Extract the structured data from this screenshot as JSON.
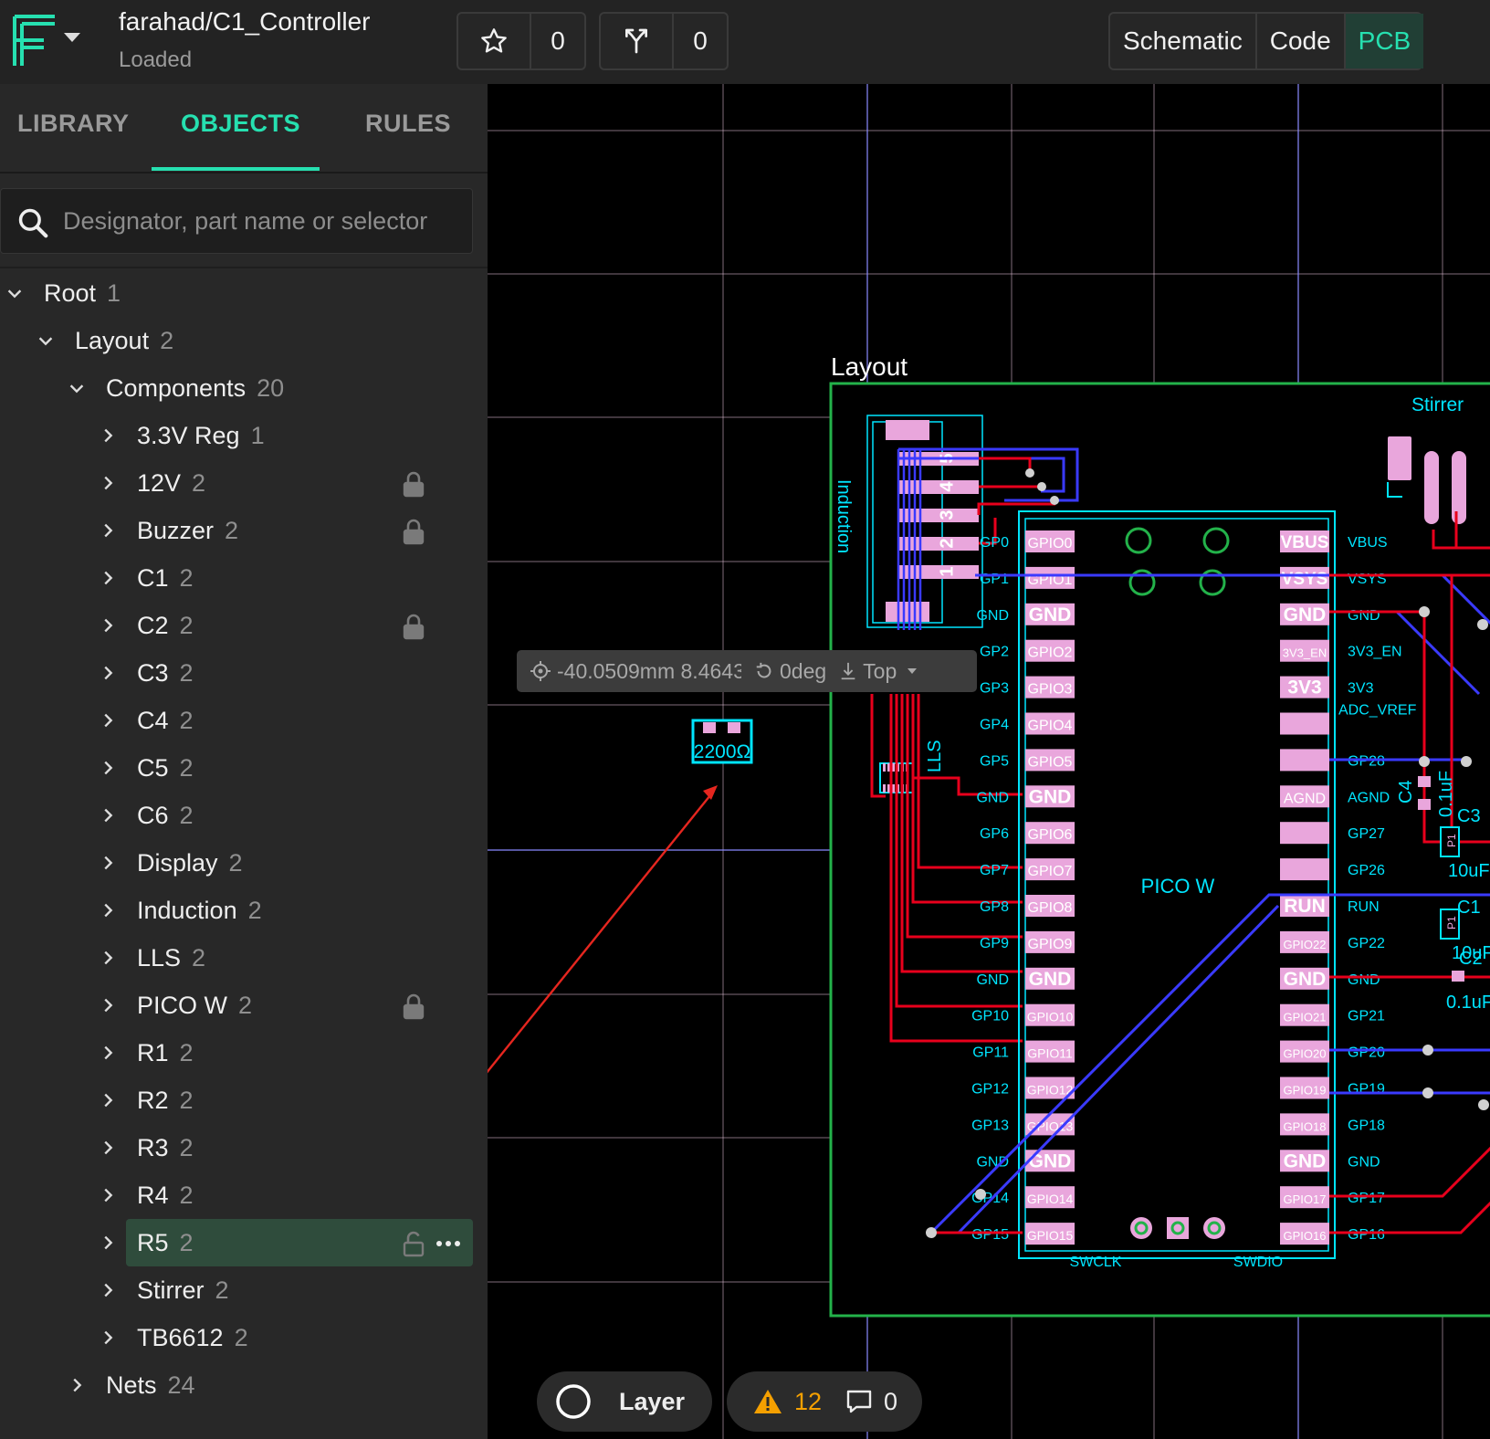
{
  "header": {
    "project_name": "farahad/C1_Controller",
    "status": "Loaded",
    "star_count": "0",
    "fork_count": "0",
    "views": [
      "Schematic",
      "Code",
      "PCB"
    ],
    "active_view": "PCB"
  },
  "sidebar": {
    "tabs": [
      "LIBRARY",
      "OBJECTS",
      "RULES"
    ],
    "active_tab": "OBJECTS",
    "search_placeholder": "Designator, part name or selector",
    "tree": {
      "root": {
        "label": "Root",
        "count": "1"
      },
      "layout": {
        "label": "Layout",
        "count": "2"
      },
      "components": {
        "label": "Components",
        "count": "20"
      },
      "items": [
        {
          "label": "3.3V Reg",
          "count": "1",
          "locked": false
        },
        {
          "label": "12V",
          "count": "2",
          "locked": true
        },
        {
          "label": "Buzzer",
          "count": "2",
          "locked": true
        },
        {
          "label": "C1",
          "count": "2",
          "locked": false
        },
        {
          "label": "C2",
          "count": "2",
          "locked": true
        },
        {
          "label": "C3",
          "count": "2",
          "locked": false
        },
        {
          "label": "C4",
          "count": "2",
          "locked": false
        },
        {
          "label": "C5",
          "count": "2",
          "locked": false
        },
        {
          "label": "C6",
          "count": "2",
          "locked": false
        },
        {
          "label": "Display",
          "count": "2",
          "locked": false
        },
        {
          "label": "Induction",
          "count": "2",
          "locked": false
        },
        {
          "label": "LLS",
          "count": "2",
          "locked": false
        },
        {
          "label": "PICO W",
          "count": "2",
          "locked": true
        },
        {
          "label": "R1",
          "count": "2",
          "locked": false
        },
        {
          "label": "R2",
          "count": "2",
          "locked": false
        },
        {
          "label": "R3",
          "count": "2",
          "locked": false
        },
        {
          "label": "R4",
          "count": "2",
          "locked": false
        },
        {
          "label": "R5",
          "count": "2",
          "locked": false,
          "selected": true
        },
        {
          "label": "Stirrer",
          "count": "2",
          "locked": false
        },
        {
          "label": "TB6612",
          "count": "2",
          "locked": false
        }
      ],
      "nets": {
        "label": "Nets",
        "count": "24"
      }
    }
  },
  "canvas": {
    "layout_label": "Layout",
    "resistor_value": "2200Ω",
    "pico_label": "PICO W",
    "induction_label": "Induction",
    "lls_label": "LLS",
    "stirrer_label": "Stirrer",
    "c4_label": "C4",
    "c3_label": "C3",
    "c4_value": "0.1uF",
    "c3_value": "10uF",
    "c2_label": "C2",
    "c1_label": "C1",
    "c2_value": "10uF",
    "c1_value": "0.1uF",
    "p1_label": "P1",
    "swclk": "SWCLK",
    "swdio": "SWDIO",
    "header_pins": [
      "5",
      "4",
      "3",
      "2",
      "1"
    ],
    "left_pins": [
      {
        "net": "GP0",
        "pad": "GPIO0"
      },
      {
        "net": "GP1",
        "pad": "GPIO1"
      },
      {
        "net": "GND",
        "pad": "GND"
      },
      {
        "net": "GP2",
        "pad": "GPIO2"
      },
      {
        "net": "GP3",
        "pad": "GPIO3"
      },
      {
        "net": "GP4",
        "pad": "GPIO4"
      },
      {
        "net": "GP5",
        "pad": "GPIO5"
      },
      {
        "net": "GND",
        "pad": "GND"
      },
      {
        "net": "GP6",
        "pad": "GPIO6"
      },
      {
        "net": "GP7",
        "pad": "GPIO7"
      },
      {
        "net": "GP8",
        "pad": "GPIO8"
      },
      {
        "net": "GP9",
        "pad": "GPIO9"
      },
      {
        "net": "GND",
        "pad": "GND"
      },
      {
        "net": "GP10",
        "pad": "GPIO10"
      },
      {
        "net": "GP11",
        "pad": "GPIO11"
      },
      {
        "net": "GP12",
        "pad": "GPIO12"
      },
      {
        "net": "GP13",
        "pad": "GPIO13"
      },
      {
        "net": "GND",
        "pad": "GND"
      },
      {
        "net": "GP14",
        "pad": "GPIO14"
      },
      {
        "net": "GP15",
        "pad": "GPIO15"
      }
    ],
    "right_pins": [
      {
        "net": "VBUS",
        "pad": "VBUS"
      },
      {
        "net": "VSYS",
        "pad": "VSYS"
      },
      {
        "net": "GND",
        "pad": "GND"
      },
      {
        "net": "3V3_EN",
        "pad": "3V3_EN"
      },
      {
        "net": "3V3",
        "pad": "3V3"
      },
      {
        "net": "ADC_VREF",
        "pad": ""
      },
      {
        "net": "GP28",
        "pad": ""
      },
      {
        "net": "AGND",
        "pad": "AGND"
      },
      {
        "net": "GP27",
        "pad": ""
      },
      {
        "net": "GP26",
        "pad": ""
      },
      {
        "net": "RUN",
        "pad": "RUN"
      },
      {
        "net": "GP22",
        "pad": "GPIO22"
      },
      {
        "net": "GND",
        "pad": "GND"
      },
      {
        "net": "GP21",
        "pad": "GPIO21"
      },
      {
        "net": "GP20",
        "pad": "GPIO20"
      },
      {
        "net": "GP19",
        "pad": "GPIO19"
      },
      {
        "net": "GP18",
        "pad": "GPIO18"
      },
      {
        "net": "GND",
        "pad": "GND"
      },
      {
        "net": "GP17",
        "pad": "GPIO17"
      },
      {
        "net": "GP16",
        "pad": "GPIO16"
      }
    ]
  },
  "coords_bar": {
    "position": "-40.0509mm 8.4643mm",
    "rotation": "0deg",
    "side": "Top"
  },
  "bottom": {
    "layer_label": "Layer",
    "warnings": "12",
    "comments": "0"
  },
  "colors": {
    "accent": "#26e0b0",
    "copper_top": "#e8001c",
    "copper_bottom": "#3a3aff",
    "silkscreen": "#00e5ff",
    "pad": "#e9a6dc",
    "board_outline": "#23b24a",
    "grid": "#e7c6de"
  }
}
